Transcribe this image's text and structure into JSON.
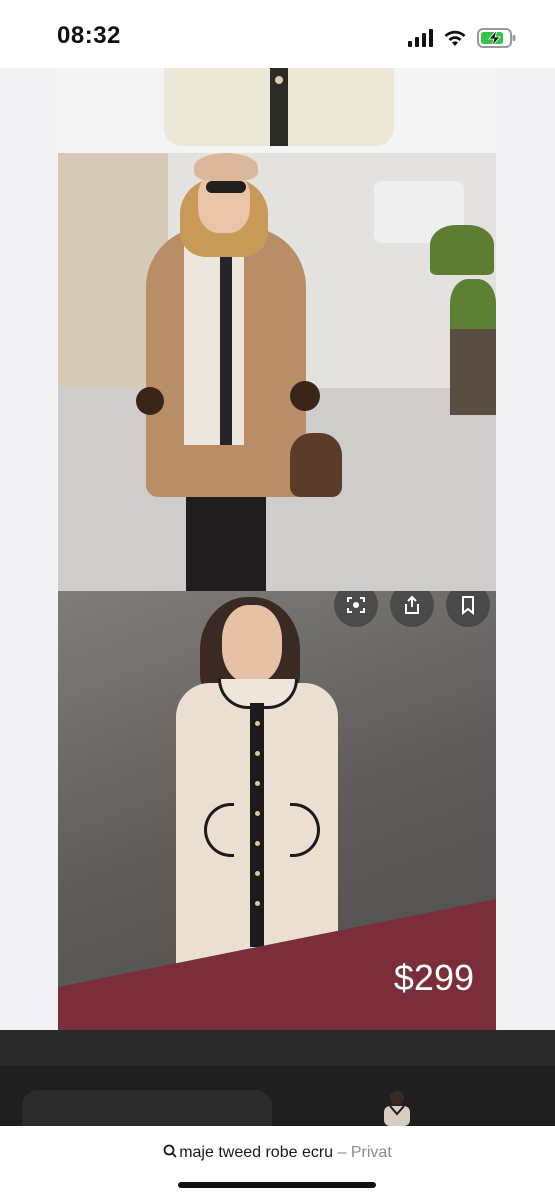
{
  "status_bar": {
    "time": "08:32",
    "icons": [
      "signal-icon",
      "wifi-icon",
      "battery-charging-icon"
    ]
  },
  "feed": {
    "images": [
      {
        "name": "tweed-skirt-partial"
      },
      {
        "name": "street-style-coat-photo"
      },
      {
        "name": "tweed-dress-product-photo",
        "price": "$299"
      }
    ]
  },
  "lens_actions": [
    "lens-search-icon",
    "share-icon",
    "bookmark-icon"
  ],
  "address_bar": {
    "query": "maje tweed robe ecru",
    "separator": "–",
    "mode": "Privat"
  },
  "colors": {
    "price_banner": "#7a2e3a",
    "background": "#f2f2f4",
    "sheet": "#1f1f1f"
  }
}
